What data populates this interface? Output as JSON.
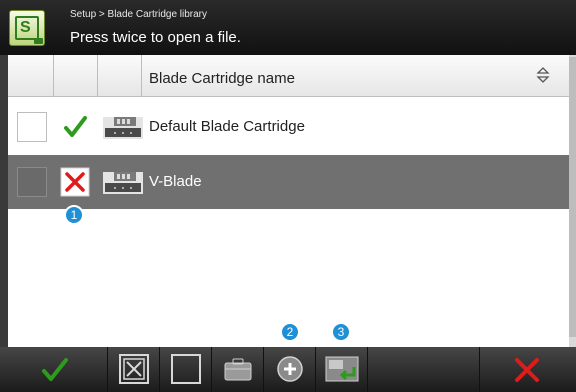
{
  "header": {
    "breadcrumb": "Setup > Blade Cartridge library",
    "hint": "Press twice to open a file."
  },
  "table": {
    "column_name_header": "Blade Cartridge name",
    "rows": [
      {
        "name": "Default Blade Cartridge",
        "status": "valid",
        "selected": false
      },
      {
        "name": "V-Blade",
        "status": "invalid",
        "selected": true
      }
    ]
  },
  "callouts": [
    "1",
    "2",
    "3"
  ],
  "toolbar": {
    "buttons": [
      "confirm",
      "deselect-all",
      "select-none",
      "open-folder",
      "add",
      "import",
      "cancel"
    ]
  },
  "colors": {
    "accent_green": "#2e9b1f",
    "cancel_red": "#e01b1b",
    "callout_blue": "#1f8fd6",
    "selected_row": "#707070"
  }
}
